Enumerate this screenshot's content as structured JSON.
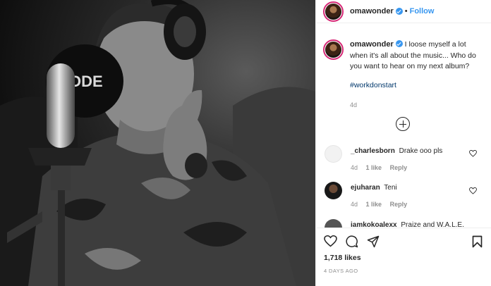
{
  "header": {
    "username": "omawonder",
    "separator": "•",
    "follow_label": "Follow"
  },
  "caption": {
    "username": "omawonder",
    "text": "I loose myself a lot when it's all about the music... Who do you want to hear on my next album?",
    "hashtag": "#workdonstart",
    "timestamp": "4d"
  },
  "photo": {
    "mic_brand": "ODE"
  },
  "comments": [
    {
      "username": "_charlesborn",
      "text": "Drake ooo pls",
      "time": "4d",
      "likes": "1 like",
      "reply": "Reply"
    },
    {
      "username": "ejuharan",
      "text": "Teni",
      "time": "4d",
      "likes": "1 like",
      "reply": "Reply"
    },
    {
      "username": "iamkokoalexx",
      "text": "Praize and W.A.L.E."
    }
  ],
  "actions": {
    "likes": "1,718 likes",
    "posted": "4 DAYS AGO"
  },
  "colors": {
    "link": "#3897f0",
    "hashtag": "#00376b",
    "muted": "#8e8e8e",
    "text": "#262626"
  }
}
